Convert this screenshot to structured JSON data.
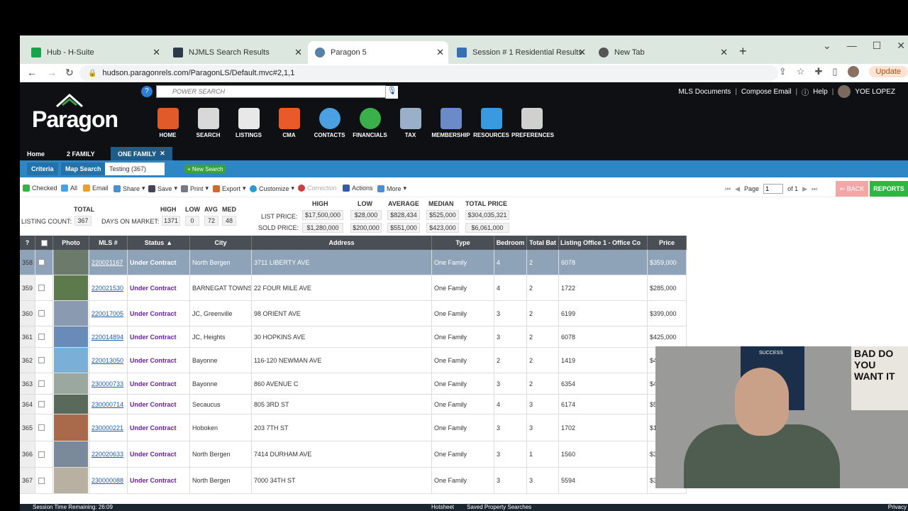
{
  "browser": {
    "tabs": [
      {
        "label": "Hub - H-Suite",
        "color": "#19a34a"
      },
      {
        "label": "NJMLS Search Results",
        "color": "#2d3a4a"
      },
      {
        "label": "Paragon 5",
        "color": "#5a7fa8"
      },
      {
        "label": "Session # 1 Residential Results",
        "color": "#3a6fb0"
      },
      {
        "label": "New Tab",
        "color": "#555555"
      }
    ],
    "url": "hudson.paragonrels.com/ParagonLS/Default.mvc#2,1,1",
    "update_label": "Update"
  },
  "header": {
    "logo_text": "Paragon",
    "power_search_placeholder": "POWER SEARCH",
    "links": [
      "MLS Documents",
      "Compose Email",
      "Help"
    ],
    "user": "YOE LOPEZ",
    "nav_icons": [
      {
        "label": "HOME",
        "color": "#e05a2a"
      },
      {
        "label": "SEARCH",
        "color": "#d8d8d8"
      },
      {
        "label": "LISTINGS",
        "color": "#e8e8e8"
      },
      {
        "label": "CMA",
        "color": "#e85a2a"
      },
      {
        "label": "CONTACTS",
        "color": "#4aa0e0"
      },
      {
        "label": "FINANCIALS",
        "color": "#3ab04a"
      },
      {
        "label": "TAX",
        "color": "#9ab0c8"
      },
      {
        "label": "MEMBERSHIP",
        "color": "#6a8ac8"
      },
      {
        "label": "RESOURCES",
        "color": "#3a9ae0"
      },
      {
        "label": "PREFERENCES",
        "color": "#d0d0d0"
      }
    ]
  },
  "subnav": {
    "tabs": [
      "Home",
      "2 FAMILY",
      "ONE FAMILY"
    ],
    "criteria_tabs": [
      "Criteria",
      "Map Search",
      "Testing (367)"
    ],
    "new_search": "New Search"
  },
  "toolbar": {
    "items": [
      "Checked",
      "All",
      "Email",
      "Share",
      "Save",
      "Print",
      "Export",
      "Customize",
      "Correction",
      "Actions",
      "More"
    ],
    "page_label": "Page",
    "page_value": "1",
    "page_of": "of 1",
    "back": "BACK",
    "reports": "REPORTS"
  },
  "stats": {
    "total_header": "TOTAL",
    "listing_count_label": "LISTING COUNT:",
    "listing_count": "367",
    "dom_headers": [
      "HIGH",
      "LOW",
      "AVG",
      "MED"
    ],
    "dom_label": "DAYS ON MARKET:",
    "dom_values": [
      "1371",
      "0",
      "72",
      "48"
    ],
    "price_headers": [
      "HIGH",
      "LOW",
      "AVERAGE",
      "MEDIAN",
      "TOTAL PRICE"
    ],
    "list_price_label": "LIST PRICE:",
    "list_price": [
      "$17,500,000",
      "$28,000",
      "$828,434",
      "$525,000",
      "$304,035,321"
    ],
    "sold_price_label": "SOLD PRICE:",
    "sold_price": [
      "$1,280,000",
      "$200,000",
      "$551,000",
      "$423,000",
      "$6,061,000"
    ]
  },
  "table": {
    "headers": [
      "?",
      "",
      "Photo",
      "MLS #",
      "Status",
      "City",
      "Address",
      "Type",
      "Bedroom",
      "Total Bat",
      "Listing Office 1 - Office Co",
      "Price"
    ],
    "rows": [
      {
        "n": "358",
        "mls": "220021167",
        "status": "Under Contract",
        "city": "North Bergen",
        "address": "3711 LIBERTY AVE",
        "type": "One Family",
        "bed": "4",
        "bath": "2",
        "office": "6078",
        "price": "$359,000",
        "selected": true,
        "photo": "#6b7a6a"
      },
      {
        "n": "359",
        "mls": "220021530",
        "status": "Under Contract",
        "city": "BARNEGAT TOWNSHIP",
        "address": "22 FOUR MILE AVE",
        "type": "One Family",
        "bed": "4",
        "bath": "2",
        "office": "1722",
        "price": "$285,000",
        "selected": false,
        "photo": "#5c7a4c"
      },
      {
        "n": "360",
        "mls": "220017005",
        "status": "Under Contract",
        "city": "JC, Greenville",
        "address": "98 ORIENT AVE",
        "type": "One Family",
        "bed": "3",
        "bath": "2",
        "office": "6199",
        "price": "$399,000",
        "selected": false,
        "photo": "#8a9ab0"
      },
      {
        "n": "361",
        "mls": "220014894",
        "status": "Under Contract",
        "city": "JC, Heights",
        "address": "30 HOPKINS AVE",
        "type": "One Family",
        "bed": "3",
        "bath": "2",
        "office": "6078",
        "price": "$425,000",
        "selected": false,
        "photo": "#6a8ab8"
      },
      {
        "n": "362",
        "mls": "220013050",
        "status": "Under Contract",
        "city": "Bayonne",
        "address": "116-120 NEWMAN AVE",
        "type": "One Family",
        "bed": "2",
        "bath": "2",
        "office": "1419",
        "price": "$4",
        "selected": false,
        "photo": "#7ab0d8"
      },
      {
        "n": "363",
        "mls": "230000733",
        "status": "Under Contract",
        "city": "Bayonne",
        "address": "860 AVENUE C",
        "type": "One Family",
        "bed": "3",
        "bath": "2",
        "office": "6354",
        "price": "$4",
        "selected": false,
        "photo": "#9aa8a0"
      },
      {
        "n": "364",
        "mls": "230000714",
        "status": "Under Contract",
        "city": "Secaucus",
        "address": "805 3RD ST",
        "type": "One Family",
        "bed": "4",
        "bath": "3",
        "office": "6174",
        "price": "$5",
        "selected": false,
        "photo": "#5a6a5a"
      },
      {
        "n": "365",
        "mls": "230000221",
        "status": "Under Contract",
        "city": "Hoboken",
        "address": "203 7TH ST",
        "type": "One Family",
        "bed": "3",
        "bath": "3",
        "office": "1702",
        "price": "$1",
        "selected": false,
        "photo": "#a86a4a"
      },
      {
        "n": "366",
        "mls": "220020633",
        "status": "Under Contract",
        "city": "North Bergen",
        "address": "7414 DURHAM AVE",
        "type": "One Family",
        "bed": "3",
        "bath": "1",
        "office": "1560",
        "price": "$3",
        "selected": false,
        "photo": "#7a8a9a"
      },
      {
        "n": "367",
        "mls": "230000088",
        "status": "Under Contract",
        "city": "North Bergen",
        "address": "7000 34TH ST",
        "type": "One Family",
        "bed": "3",
        "bath": "3",
        "office": "5594",
        "price": "$3",
        "selected": false,
        "photo": "#b8b0a0"
      }
    ]
  },
  "webcam": {
    "sign_text": "BAD DO YOU WANT IT",
    "board_text": "SUCCESS"
  },
  "statusbar": {
    "session": "Session Time Remaining: 26:09",
    "links": [
      "Hotsheet",
      "Saved Property Searches"
    ],
    "privacy": "Privacy"
  }
}
